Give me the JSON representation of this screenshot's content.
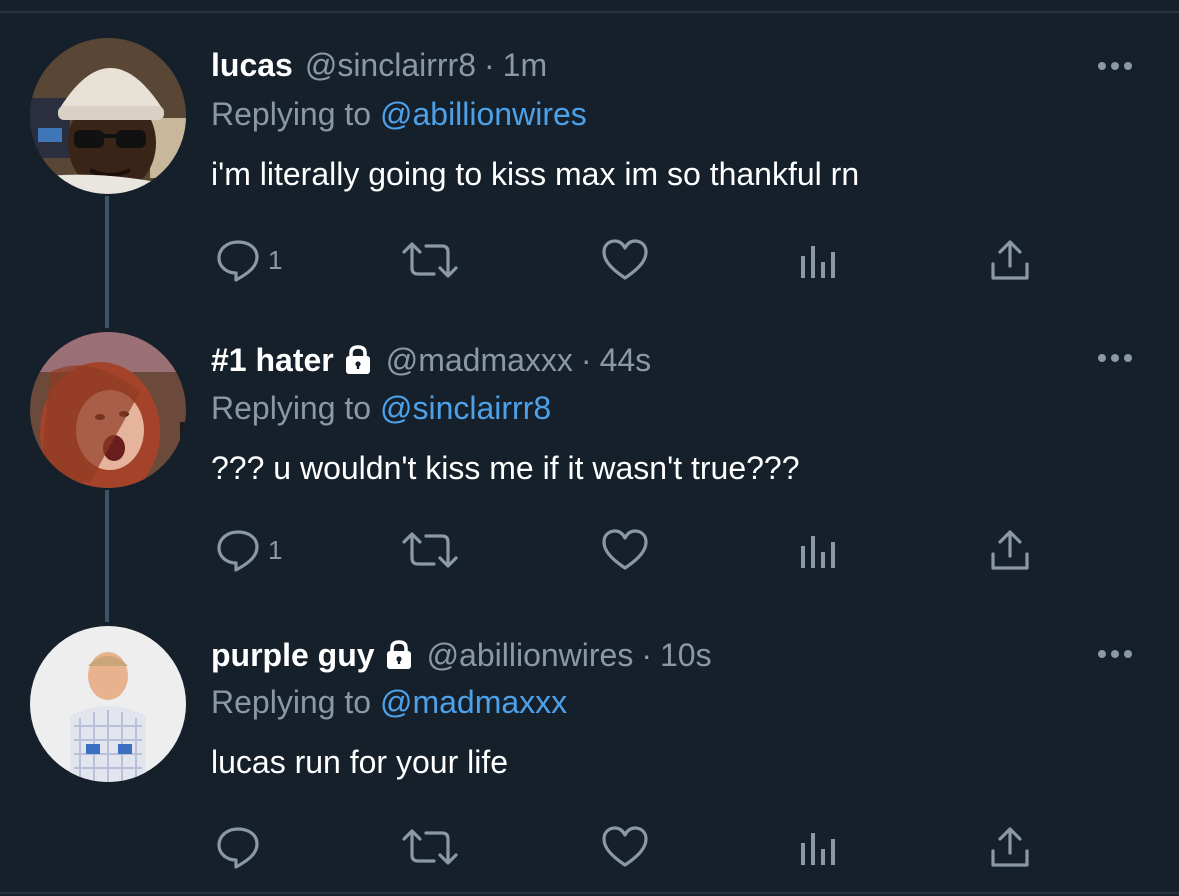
{
  "colors": {
    "background": "#15202b",
    "text": "#ffffff",
    "muted": "#8b98a5",
    "link": "#4da1e8",
    "thread_line": "#3d5466"
  },
  "tweets": [
    {
      "display_name": "lucas",
      "protected": false,
      "handle": "@sinclairrr8",
      "separator": "·",
      "time": "1m",
      "replying_prefix": "Replying to",
      "replying_to": "@abillionwires",
      "text": "i'm literally going to kiss max im so thankful rn",
      "reply_count": "1",
      "avatar_icon": "avatar-man-with-beanie-and-sunglasses",
      "more_icon": "more-dots-icon"
    },
    {
      "display_name": "#1 hater",
      "protected": true,
      "handle": "@madmaxxx",
      "separator": "·",
      "time": "44s",
      "replying_prefix": "Replying to",
      "replying_to": "@sinclairrr8",
      "text": "??? u wouldn't kiss me if it wasn't true???",
      "reply_count": "1",
      "avatar_icon": "avatar-child-with-red-hair",
      "more_icon": "more-dots-icon"
    },
    {
      "display_name": "purple guy",
      "protected": true,
      "handle": "@abillionwires",
      "separator": "·",
      "time": "10s",
      "replying_prefix": "Replying to",
      "replying_to": "@madmaxxx",
      "text": "lucas run for your life",
      "reply_count": "",
      "avatar_icon": "avatar-man-in-plaid-shirt",
      "more_icon": "more-dots-icon"
    }
  ],
  "action_icons": [
    "reply-icon",
    "retweet-icon",
    "like-icon",
    "analytics-icon",
    "share-icon"
  ]
}
